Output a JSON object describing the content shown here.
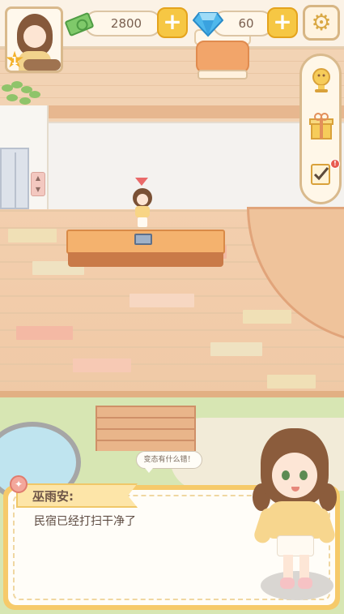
{
  "hud": {
    "level": "1",
    "cash": "2800",
    "gems": "60"
  },
  "npc_bubble": "变态有什么错！",
  "dialog": {
    "speaker": "巫雨安:",
    "text": "民宿已经打扫干净了"
  },
  "colors": {
    "accent": "#f6c744",
    "dialog_border": "#f6ca6a",
    "floor": "#f3cfae"
  },
  "icons": {
    "cash": "cash-icon",
    "gem": "gem-icon",
    "settings": "gear-icon",
    "trophy": "trophy-icon",
    "gift": "gift-icon",
    "tasks": "checklist-icon"
  }
}
